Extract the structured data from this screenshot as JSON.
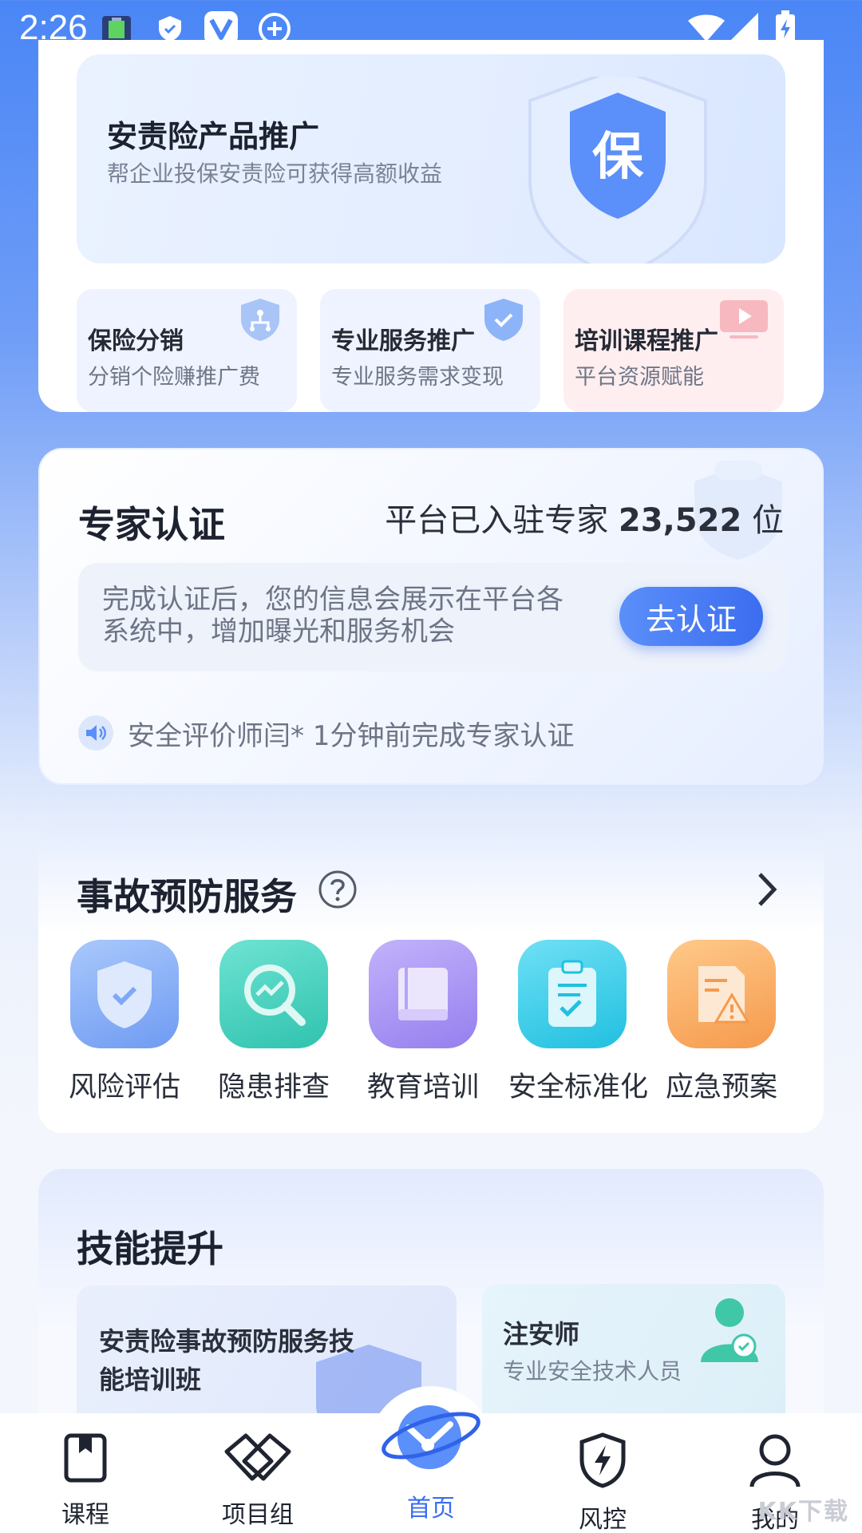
{
  "status_bar": {
    "time": "2:26"
  },
  "promo": {
    "title": "安责险产品推广",
    "subtitle": "帮企业投保安责险可获得高额收益",
    "badge_char": "保",
    "tiles": [
      {
        "title": "保险分销",
        "subtitle": "分销个险赚推广费",
        "icon": "shield-tree-icon",
        "color": "#eef3ff"
      },
      {
        "title": "专业服务推广",
        "subtitle": "专业服务需求变现",
        "icon": "shield-check-icon",
        "color": "#eef3ff"
      },
      {
        "title": "培训课程推广",
        "subtitle": "平台资源赋能",
        "icon": "video-play-icon",
        "color": "#ffeef0"
      }
    ]
  },
  "expert": {
    "title": "专家认证",
    "count_prefix": "平台已入驻专家",
    "count_value": "23,522",
    "count_suffix": "位",
    "description": "完成认证后，您的信息会展示在平台各系统中，增加曝光和服务机会",
    "button": "去认证",
    "notice": "安全评价师闫* 1分钟前完成专家认证"
  },
  "prevention": {
    "title": "事故预防服务",
    "services": [
      {
        "label": "风险评估",
        "icon": "shield-check-icon",
        "color": "#7fa8f5"
      },
      {
        "label": "隐患排查",
        "icon": "magnifier-chart-icon",
        "color": "#3fd3c0"
      },
      {
        "label": "教育培训",
        "icon": "book-icon",
        "color": "#a08af0"
      },
      {
        "label": "安全标准化",
        "icon": "clipboard-check-icon",
        "color": "#2fc8e6"
      },
      {
        "label": "应急预案",
        "icon": "warning-doc-icon",
        "color": "#f8a85c"
      }
    ]
  },
  "skills": {
    "title": "技能提升",
    "card_a": "安责险事故预防服务技能培训班",
    "card_b_title": "注安师",
    "card_b_subtitle": "专业安全技术人员"
  },
  "nav": {
    "items": [
      "课程",
      "项目组",
      "首页",
      "风控",
      "我的"
    ],
    "active_color": "#3b6df0"
  },
  "watermark": "KK下载"
}
